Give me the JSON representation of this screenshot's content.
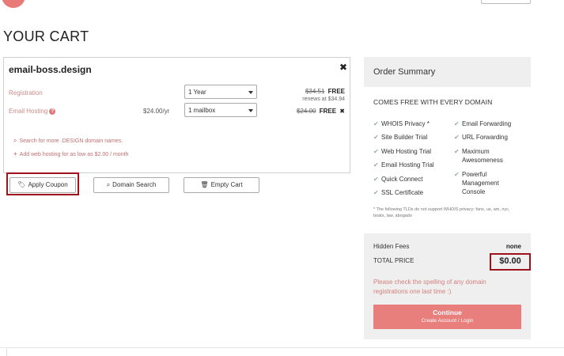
{
  "header": {
    "title": "YOUR CART"
  },
  "cart": {
    "domain": "email-boss.design",
    "close_symbol": "✖",
    "registration": {
      "label": "Registration",
      "selected": "1 Year",
      "old_price": "$34.51",
      "free": "FREE",
      "renews": "renews at $34.94"
    },
    "hosting": {
      "label": "Email Hosting",
      "help": "?",
      "price": "$24.00/yr",
      "selected": "1 mailbox",
      "old_price": "$24.00",
      "free": "FREE",
      "remove": "✖"
    },
    "tips": [
      {
        "icon": "⌕",
        "text": "Search for more .DESIGN domain names."
      },
      {
        "icon": "+",
        "text": "Add web hosting for as low as $2.00 / month"
      }
    ]
  },
  "actions": {
    "apply_coupon": "Apply Coupon",
    "domain_search": "Domain Search",
    "empty_cart": "Empty Cart"
  },
  "summary": {
    "title": "Order Summary",
    "comes_free": "COMES FREE WITH EVERY DOMAIN",
    "features_left": [
      "WHOIS Privacy *",
      "Site Builder Trial",
      "Web Hosting Trial",
      "Email Hosting Trial",
      "Quick Connect",
      "SSL Certificate"
    ],
    "features_right": [
      "Email Forwarding",
      "URL Forwarding",
      "Maximum Awesomeness",
      "Powerful Management Console"
    ],
    "footnote": "* The following TLDs do not support WHOIS privacy: fans, us, am, nyc, boats, law, abogado"
  },
  "totals": {
    "hidden_fees_label": "Hidden Fees",
    "hidden_fees_value": "none",
    "total_label": "TOTAL PRICE",
    "total_value": "$0.00",
    "warning": "Please check the spelling of any domain registrations one last time :)",
    "continue_label": "Continue",
    "continue_sub": "Create Account / Login"
  },
  "colors": {
    "accent": "#e87f7d",
    "highlight_border": "#a0121b",
    "panel_bg": "#efefef"
  }
}
